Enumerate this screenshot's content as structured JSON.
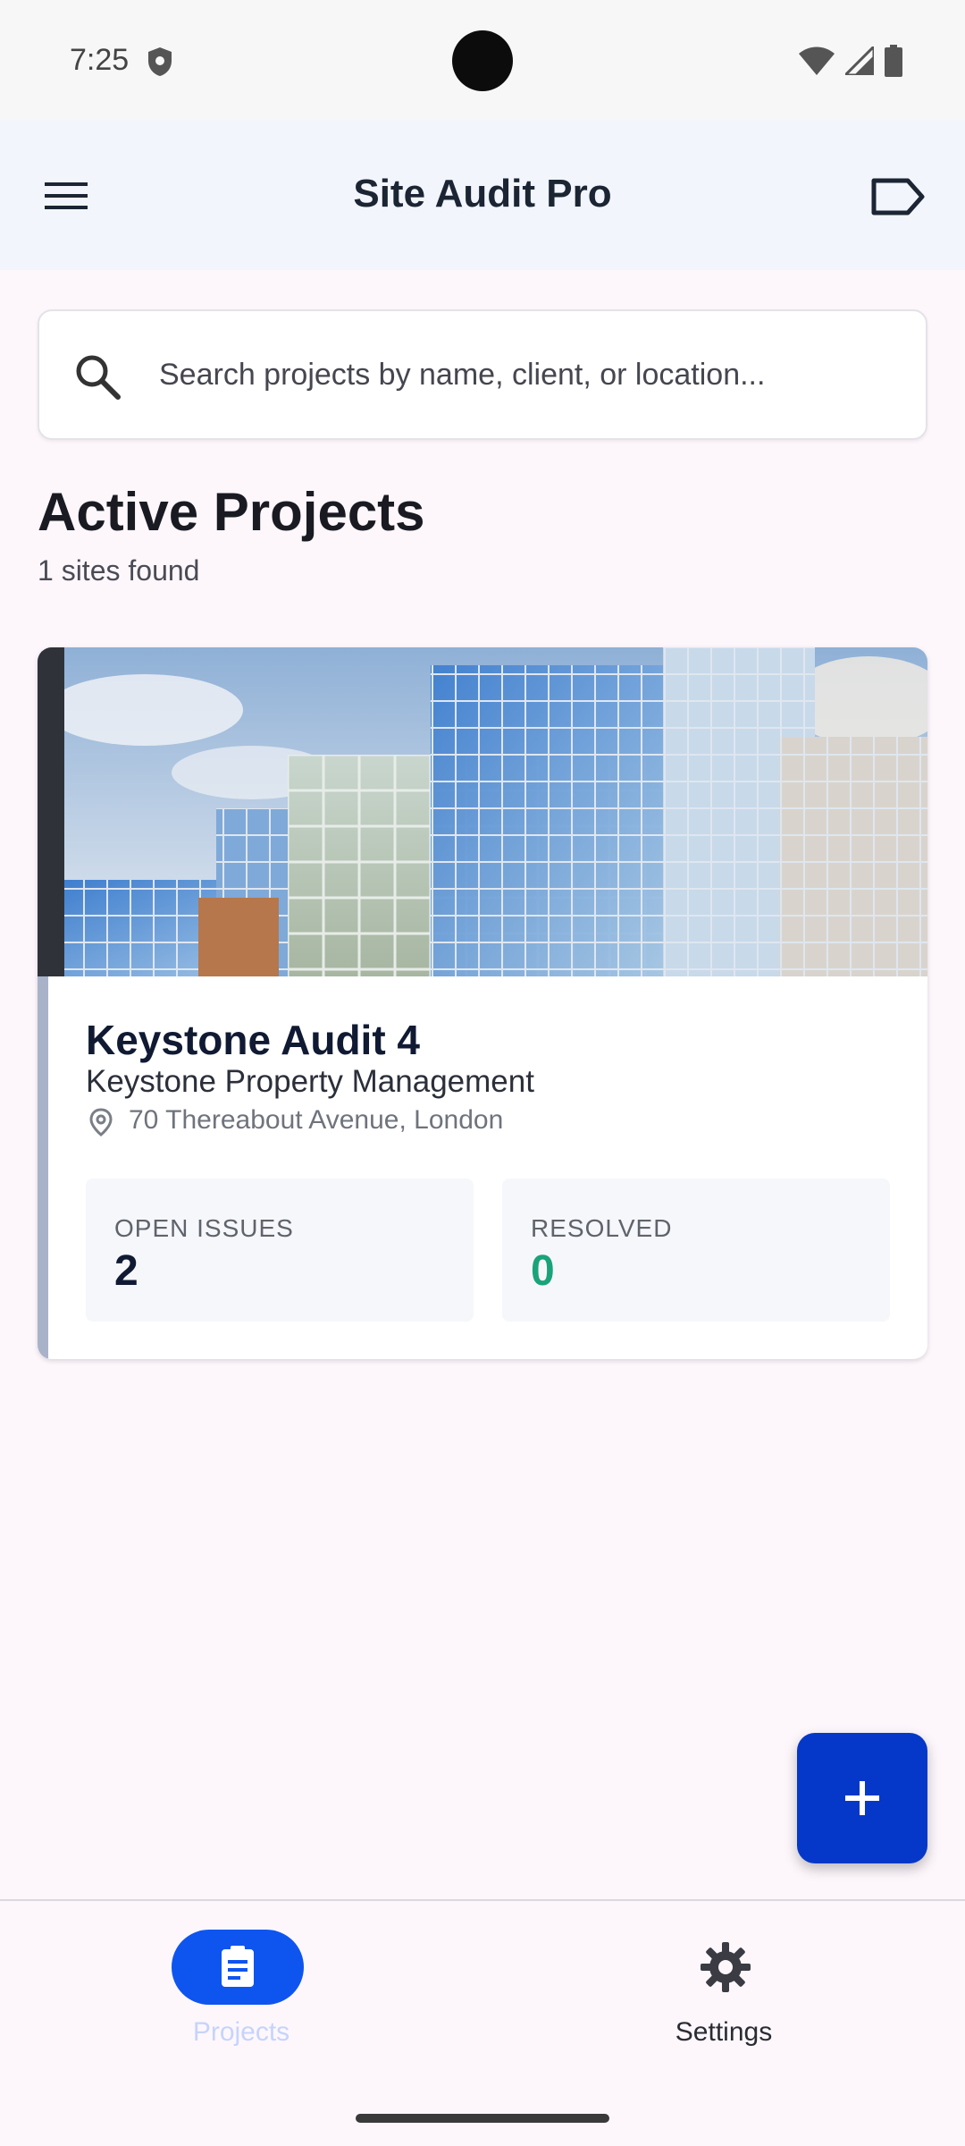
{
  "status_bar": {
    "time": "7:25",
    "icons": [
      "shield-icon",
      "wifi-icon",
      "signal-icon",
      "battery-icon"
    ]
  },
  "app_bar": {
    "title": "Site Audit Pro",
    "menu_icon": "menu-icon",
    "action_icon": "label-icon"
  },
  "search": {
    "placeholder": "Search projects by name, client, or location...",
    "value": "",
    "icon": "search-icon"
  },
  "section": {
    "title": "Active Projects",
    "count_text": "1 sites found"
  },
  "projects": [
    {
      "name": "Keystone Audit 4",
      "client": "Keystone Property Management",
      "address": "70 Thereabout Avenue, London",
      "stats": {
        "open_label": "OPEN ISSUES",
        "open_value": "2",
        "resolved_label": "RESOLVED",
        "resolved_value": "0"
      }
    }
  ],
  "fab": {
    "icon": "plus-icon"
  },
  "bottom_nav": {
    "items": [
      {
        "label": "Projects",
        "icon": "clipboard-icon",
        "active": true
      },
      {
        "label": "Settings",
        "icon": "gear-icon",
        "active": false
      }
    ]
  },
  "colors": {
    "primary": "#0538c8",
    "nav_active": "#0e55f0",
    "resolved_green": "#1aa37a",
    "open_dark": "#101a33",
    "card_accent": "#a8b3c9"
  }
}
